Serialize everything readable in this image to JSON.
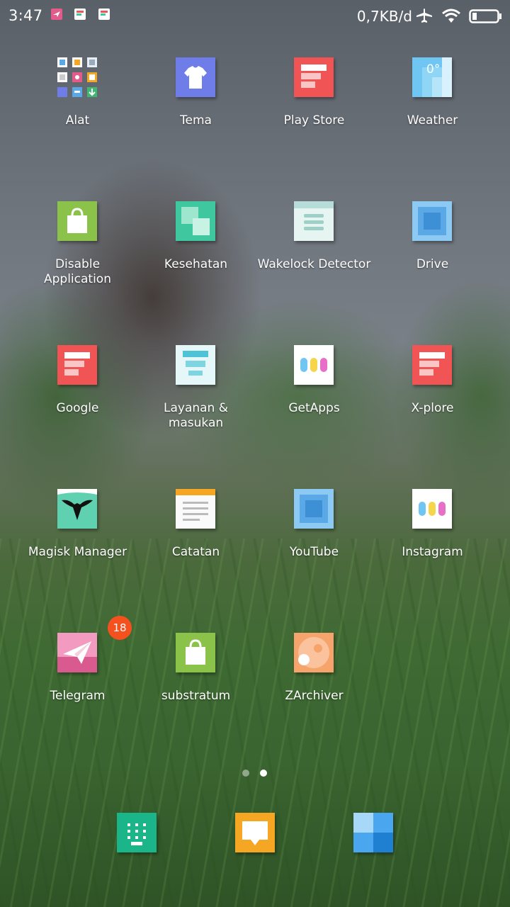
{
  "status_bar": {
    "time": "3:47",
    "network_speed": "0,7KB/d",
    "notification_icons": [
      "telegram-notif-icon",
      "playstore-notif-icon",
      "playstore-notif-icon-2"
    ],
    "status_icons": [
      "airplane-mode-icon",
      "wifi-icon",
      "battery-icon"
    ]
  },
  "apps": [
    {
      "label": "Alat",
      "icon": "tools-folder-icon"
    },
    {
      "label": "Tema",
      "icon": "tshirt-icon"
    },
    {
      "label": "Play Store",
      "icon": "play-store-icon"
    },
    {
      "label": "Weather",
      "icon": "weather-icon",
      "icon_text": "0°"
    },
    {
      "label": "Disable Application",
      "icon": "bag-icon"
    },
    {
      "label": "Kesehatan",
      "icon": "health-icon"
    },
    {
      "label": "Wakelock Detector",
      "icon": "wakelock-icon"
    },
    {
      "label": "Drive",
      "icon": "drive-icon"
    },
    {
      "label": "Google",
      "icon": "google-icon"
    },
    {
      "label": "Layanan & masukan",
      "icon": "feedback-icon"
    },
    {
      "label": "GetApps",
      "icon": "getapps-icon"
    },
    {
      "label": "X-plore",
      "icon": "xplore-icon"
    },
    {
      "label": "Magisk Manager",
      "icon": "magisk-icon"
    },
    {
      "label": "Catatan",
      "icon": "notes-icon"
    },
    {
      "label": "YouTube",
      "icon": "youtube-icon"
    },
    {
      "label": "Instagram",
      "icon": "instagram-icon"
    },
    {
      "label": "Telegram",
      "icon": "telegram-icon",
      "badge": "18"
    },
    {
      "label": "substratum",
      "icon": "substratum-icon"
    },
    {
      "label": "ZArchiver",
      "icon": "zarchiver-icon"
    }
  ],
  "page_indicator": {
    "pages": 2,
    "current": 2
  },
  "dock": [
    {
      "icon": "dialer-icon"
    },
    {
      "icon": "messages-icon"
    },
    {
      "icon": "windows-tile-icon"
    }
  ],
  "colors": {
    "red": "#f05454",
    "green": "#8bc34a",
    "teal": "#3fc8a0",
    "blue": "#5aa8e6",
    "purple": "#6f7de8",
    "orange": "#f5a623",
    "badge": "#f4511e"
  }
}
